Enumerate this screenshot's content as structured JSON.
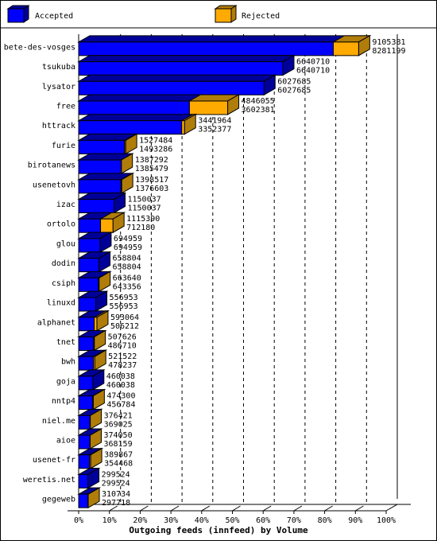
{
  "chart_data": {
    "type": "bar",
    "orientation": "horizontal",
    "stacked": true,
    "three_d": true,
    "title": "",
    "xlabel": "Outgoing feeds (innfeed) by Volume",
    "ylabel": "",
    "xlim_percent": [
      0,
      100
    ],
    "x_ticks": [
      "0%",
      "10%",
      "20%",
      "30%",
      "40%",
      "50%",
      "60%",
      "70%",
      "80%",
      "90%",
      "100%"
    ],
    "grid": true,
    "legend_position": "top",
    "legend": [
      {
        "name": "Accepted",
        "color": "#0000ff"
      },
      {
        "name": "Rejected",
        "color": "#ffaa00"
      }
    ],
    "categories": [
      "bete-des-vosges",
      "tsukuba",
      "lysator",
      "free",
      "httrack",
      "furie",
      "birotanews",
      "usenetovh",
      "izac",
      "ortolo",
      "glou",
      "dodin",
      "csiph",
      "linuxd",
      "alphanet",
      "tnet",
      "bwh",
      "goja",
      "nntp4",
      "niel.me",
      "aioe",
      "usenet-fr",
      "weretis.net",
      "gegeweb"
    ],
    "totals": [
      9105381,
      6640710,
      6027685,
      4846055,
      3441964,
      1527484,
      1387292,
      1398517,
      1150037,
      1115390,
      694959,
      658804,
      663640,
      556953,
      593064,
      507626,
      521522,
      460038,
      474300,
      376421,
      374050,
      389867,
      299524,
      310734
    ],
    "series": [
      {
        "name": "Accepted",
        "values": [
          8281199,
          6640710,
          6027685,
          3602381,
          3352377,
          1493286,
          1385479,
          1376603,
          1150037,
          712180,
          694959,
          658804,
          643356,
          556953,
          506212,
          486710,
          478237,
          460038,
          456784,
          369025,
          368159,
          354468,
          299524,
          297718
        ]
      },
      {
        "name": "Rejected",
        "values": [
          824182,
          0,
          0,
          1243674,
          89587,
          34198,
          1813,
          21914,
          0,
          403210,
          0,
          0,
          20284,
          0,
          86852,
          20916,
          43285,
          0,
          17516,
          7396,
          5891,
          35399,
          0,
          13016
        ]
      }
    ],
    "scale_max": 10000000
  }
}
